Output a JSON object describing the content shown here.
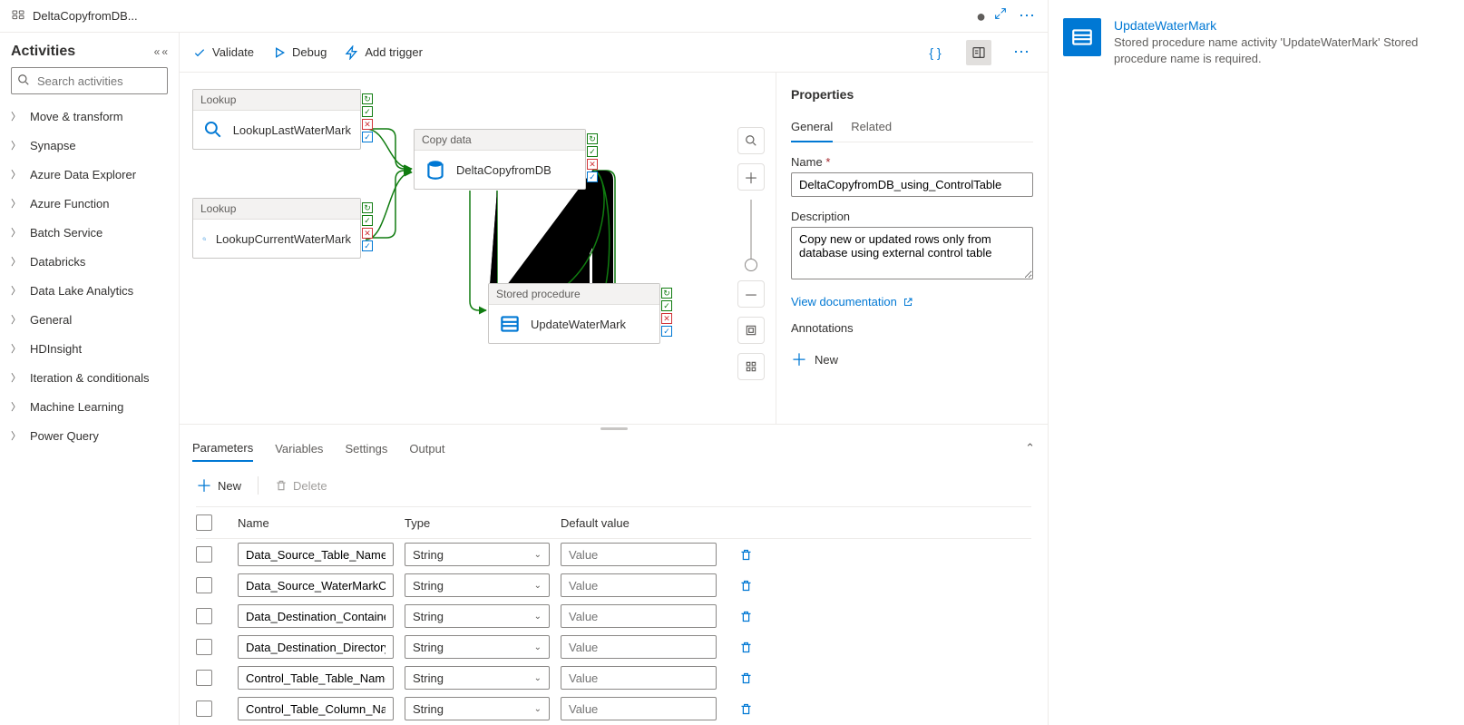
{
  "titlebar": {
    "title": "DeltaCopyfromDB..."
  },
  "activities": {
    "header": "Activities",
    "search_placeholder": "Search activities",
    "categories": [
      "Move & transform",
      "Synapse",
      "Azure Data Explorer",
      "Azure Function",
      "Batch Service",
      "Databricks",
      "Data Lake Analytics",
      "General",
      "HDInsight",
      "Iteration & conditionals",
      "Machine Learning",
      "Power Query"
    ]
  },
  "toolbar": {
    "validate": "Validate",
    "debug": "Debug",
    "addtrigger": "Add trigger"
  },
  "nodes": {
    "n1": {
      "type": "Lookup",
      "label": "LookupLastWaterMark"
    },
    "n2": {
      "type": "Lookup",
      "label": "LookupCurrentWaterMark"
    },
    "n3": {
      "type": "Copy data",
      "label": "DeltaCopyfromDB"
    },
    "n4": {
      "type": "Stored procedure",
      "label": "UpdateWaterMark"
    }
  },
  "props": {
    "title": "Properties",
    "tabs": {
      "general": "General",
      "related": "Related"
    },
    "name_label": "Name",
    "name_value": "DeltaCopyfromDB_using_ControlTable",
    "desc_label": "Description",
    "desc_value": "Copy new or updated rows only from database using external control table",
    "doc_link": "View documentation",
    "annotations": "Annotations",
    "new": "New"
  },
  "bottom": {
    "tabs": {
      "parameters": "Parameters",
      "variables": "Variables",
      "settings": "Settings",
      "output": "Output"
    },
    "new": "New",
    "delete": "Delete",
    "headers": {
      "name": "Name",
      "type": "Type",
      "default": "Default value"
    },
    "type_value": "String",
    "value_placeholder": "Value",
    "rows": [
      {
        "name": "Data_Source_Table_Name"
      },
      {
        "name": "Data_Source_WaterMarkColumn"
      },
      {
        "name": "Data_Destination_Container"
      },
      {
        "name": "Data_Destination_Directory"
      },
      {
        "name": "Control_Table_Table_Name"
      },
      {
        "name": "Control_Table_Column_Name"
      }
    ]
  },
  "error": {
    "title": "UpdateWaterMark",
    "msg": "Stored procedure name activity 'UpdateWaterMark' Stored procedure name is required."
  }
}
